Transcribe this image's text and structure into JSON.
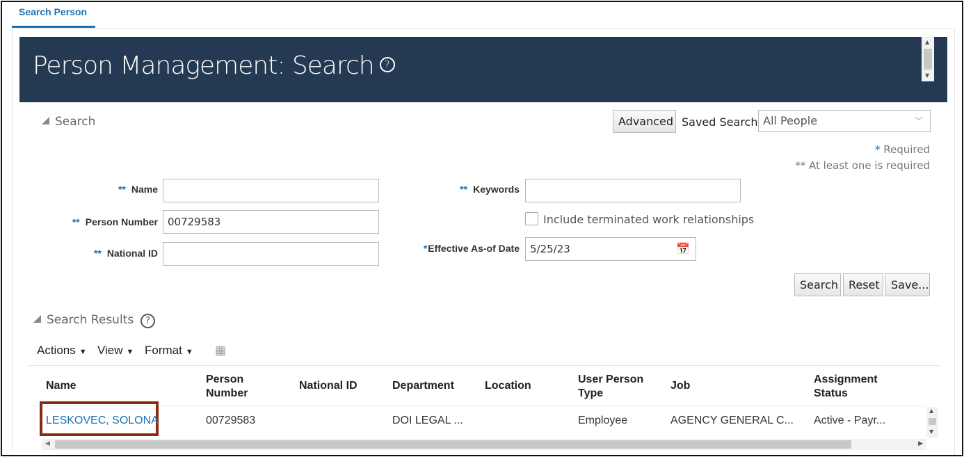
{
  "tab": {
    "label": "Search Person"
  },
  "header": {
    "title": "Person Management: Search",
    "help": "?"
  },
  "search": {
    "section": "Search",
    "advanced": "Advanced",
    "saved_search_label": "Saved Search",
    "saved_search_value": "All People",
    "required_note": "Required",
    "required_star": "*",
    "at_least_note": "** At least one is required",
    "fields": {
      "name_label": "Name",
      "name_value": "",
      "person_number_label": "Person Number",
      "person_number_value": "00729583",
      "national_id_label": "National ID",
      "national_id_value": "",
      "keywords_label": "Keywords",
      "keywords_value": "",
      "terminated_label": "Include terminated work relationships",
      "effective_label": "Effective As-of Date",
      "effective_value": "5/25/23",
      "dstar": "**",
      "star": "*"
    },
    "buttons": {
      "search": "Search",
      "reset": "Reset",
      "save": "Save..."
    }
  },
  "results": {
    "section": "Search Results",
    "toolbar": {
      "actions": "Actions",
      "view": "View",
      "format": "Format"
    },
    "columns": [
      "Name",
      "Person\nNumber",
      "National ID",
      "Department",
      "Location",
      "User Person\nType",
      "Job",
      "Assignment\nStatus"
    ],
    "rows": [
      {
        "name": "LESKOVEC, SOLONA",
        "person_number": "00729583",
        "national_id": "",
        "department": "DOI LEGAL ...",
        "location": "",
        "user_person_type": "Employee",
        "job": "AGENCY GENERAL C...",
        "assignment_status": "Active - Payr..."
      }
    ]
  },
  "colors": {
    "header": "#243a52",
    "link": "#1a73b0",
    "highlight": "#8b2a10"
  }
}
